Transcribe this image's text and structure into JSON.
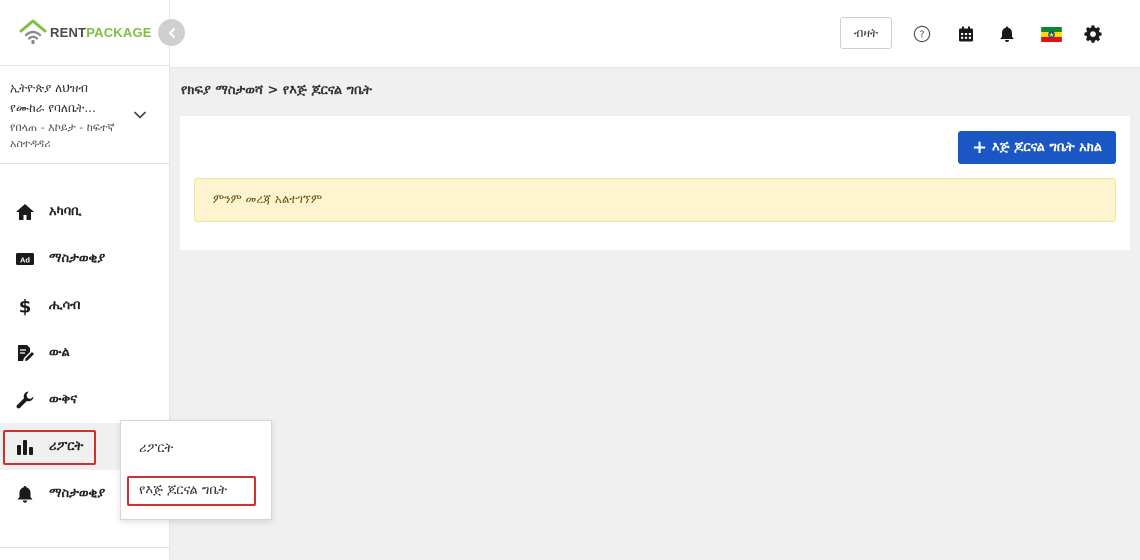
{
  "logo": {
    "rent": "RENT",
    "package": "PACKAGE"
  },
  "account": {
    "name": "ኢትዮጵያ ለህዝብ የሙከራ የባለቤት...",
    "role": "የበላጠ - እኮይታ - ከፍተኛ አስተዳዳሪ"
  },
  "sidebar": {
    "items": [
      {
        "label": "አካባቢ",
        "icon": "home-icon"
      },
      {
        "label": "ማስታወቂያ",
        "icon": "ad-icon"
      },
      {
        "label": "ሒሳብ",
        "icon": "dollar-icon"
      },
      {
        "label": "ውል",
        "icon": "contract-icon"
      },
      {
        "label": "ውቅና",
        "icon": "wrench-icon"
      },
      {
        "label": "ሪፖርት",
        "icon": "bar-chart-icon"
      },
      {
        "label": "ማስታወቂያ",
        "icon": "bell-icon"
      }
    ]
  },
  "header": {
    "view_button": "ብዛት",
    "icons": [
      "help-icon",
      "calendar-icon",
      "bell-icon",
      "flag-icon",
      "gear-icon"
    ]
  },
  "breadcrumb": "የክፍያ ማስታወሻ > የእጅ ጆርናል ግቤት",
  "main": {
    "add_button": "እጅ ጆርናል ግቤት አክል",
    "empty_message": "ምንም መረጃ አልተገኘም"
  },
  "submenu": {
    "items": [
      "ሪፖርት",
      "የእጅ ጆርናል ግቤት"
    ]
  },
  "colors": {
    "primary": "#1a56c4",
    "brand_green": "#7cc242",
    "alert_bg": "#fff4cf",
    "highlight_red": "#d32f2f"
  }
}
